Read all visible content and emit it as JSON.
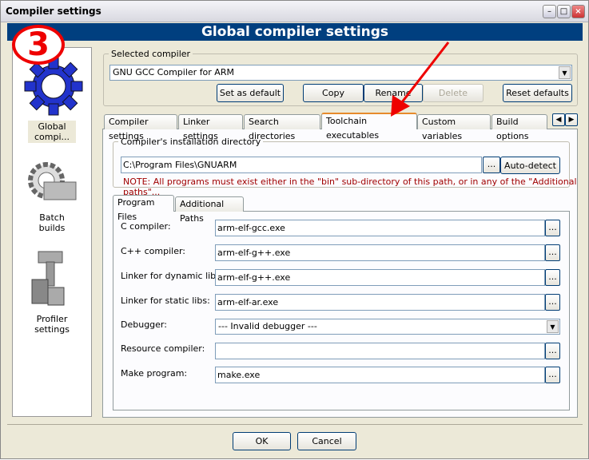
{
  "window": {
    "title": "Compiler settings",
    "header": "Global compiler settings",
    "step_badge": "3"
  },
  "sidebar": {
    "items": [
      {
        "label": "Global compi...",
        "icon": "gear-icon"
      },
      {
        "label": "Batch builds",
        "icon": "batch-gear-icon"
      },
      {
        "label": "Profiler settings",
        "icon": "profiler-icon"
      }
    ]
  },
  "selected_compiler": {
    "legend": "Selected compiler",
    "value": "GNU GCC Compiler for ARM",
    "buttons": {
      "set_default": "Set as default",
      "copy": "Copy",
      "rename": "Rename",
      "delete": "Delete",
      "reset": "Reset defaults"
    }
  },
  "tabs": [
    "Compiler settings",
    "Linker settings",
    "Search directories",
    "Toolchain executables",
    "Custom variables",
    "Build options"
  ],
  "active_tab": "Toolchain executables",
  "install_dir": {
    "legend": "Compiler's installation directory",
    "value": "C:\\Program Files\\GNUARM",
    "browse": "...",
    "autodetect": "Auto-detect",
    "note": "NOTE: All programs must exist either in the \"bin\" sub-directory of this path, or in any of the \"Additional paths\"..."
  },
  "inner_tabs": [
    "Program Files",
    "Additional Paths"
  ],
  "programs": [
    {
      "label": "C compiler:",
      "value": "arm-elf-gcc.exe"
    },
    {
      "label": "C++ compiler:",
      "value": "arm-elf-g++.exe"
    },
    {
      "label": "Linker for dynamic libs:",
      "value": "arm-elf-g++.exe"
    },
    {
      "label": "Linker for static libs:",
      "value": "arm-elf-ar.exe"
    },
    {
      "label": "Debugger:",
      "value": "--- Invalid debugger ---"
    },
    {
      "label": "Resource compiler:",
      "value": ""
    },
    {
      "label": "Make program:",
      "value": "make.exe"
    }
  ],
  "browse_label": "...",
  "footer": {
    "ok": "OK",
    "cancel": "Cancel"
  },
  "colors": {
    "header": "#003f7f",
    "note": "#a00000",
    "annotation": "#e00000"
  }
}
